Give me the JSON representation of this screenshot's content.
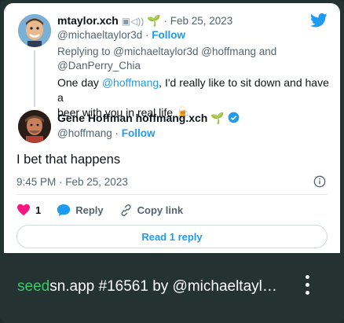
{
  "tweet_parent": {
    "display_name": "mtaylor.xch",
    "name_emoji": "🌱",
    "date": "Feb 25, 2023",
    "handle": "@michaeltaylor3d",
    "follow_label": "Follow",
    "reply_to_line1": "Replying to @michaeltaylor3d @hoffmang and",
    "reply_to_line2": "@DanPerry_Chia",
    "text_before": "One day ",
    "mention": "@hoffmang",
    "text_after": ", I'd really like to sit down and have a",
    "text_line2": "beer with you in real life",
    "beer_emoji": "🍺"
  },
  "tweet_main": {
    "display_name": "Gene Hoffman hoffmang.xch",
    "name_emoji": "🌱",
    "handle": "@hoffmang",
    "follow_label": "Follow",
    "text": "I bet that happens",
    "timestamp": "9:45 PM · Feb 25, 2023",
    "like_count": "1",
    "reply_label": "Reply",
    "copy_link_label": "Copy link",
    "read_replies_label": "Read 1 reply"
  },
  "footer": {
    "brand_prefix": "seed",
    "brand_rest": "sn.app #16561 by @michaeltayl…"
  },
  "colors": {
    "twitter_blue": "#1d9bf0",
    "like_pink": "#f91880",
    "seed_green": "#39c86a",
    "footer_bg": "#243232"
  },
  "icons": [
    "twitter-bird-icon",
    "verified-badge-icon",
    "heart-icon",
    "reply-bubble-icon",
    "link-icon",
    "info-icon",
    "more-vertical-icon"
  ]
}
